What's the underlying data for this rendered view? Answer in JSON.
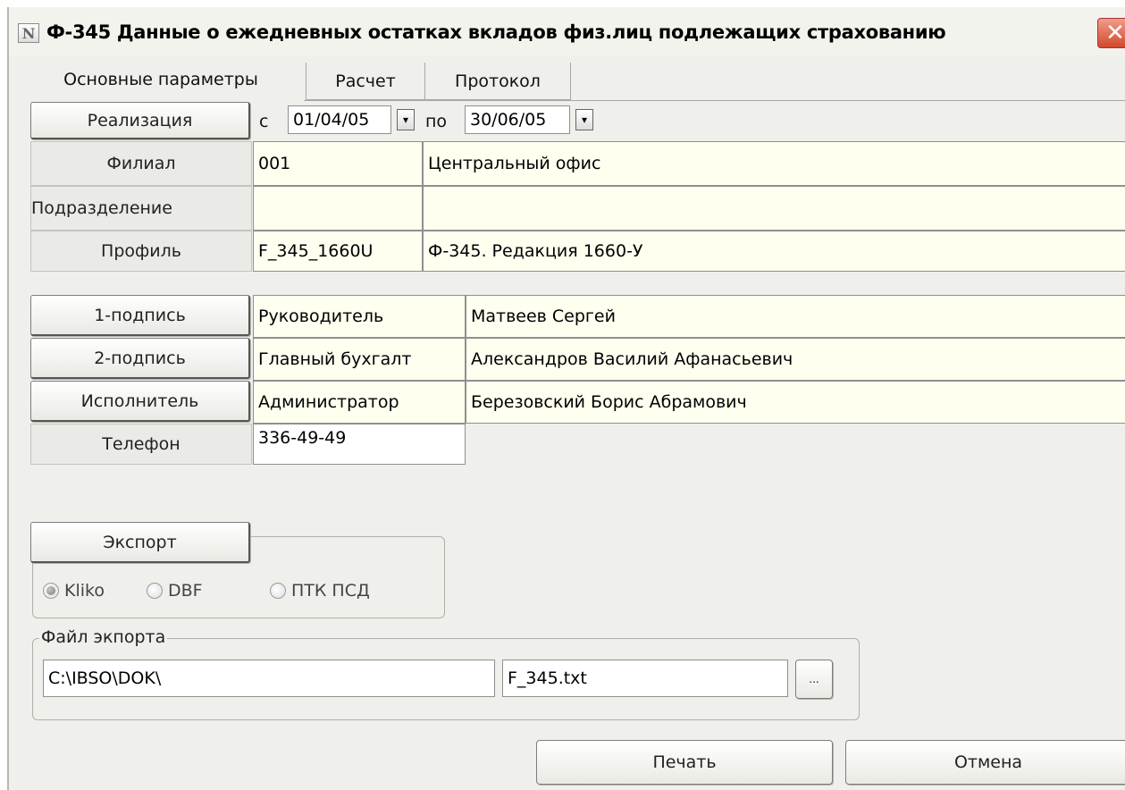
{
  "window": {
    "title": "Ф-345 Данные о ежедневных остатках вкладов физ.лиц подлежащих страхованию",
    "app_icon": "app-logo-icon",
    "close_glyph": "✕"
  },
  "tabs": [
    {
      "label": "Основные параметры",
      "active": true
    },
    {
      "label": "Расчет",
      "active": false
    },
    {
      "label": "Протокол",
      "active": false
    }
  ],
  "period": {
    "button_label": "Реализация",
    "from_label": "с",
    "from_value": "01/04/05",
    "to_label": "по",
    "to_value": "30/06/05",
    "dropdown_glyph": "▾"
  },
  "branch": {
    "label": "Филиал",
    "code": "001",
    "name": "Центральный офис"
  },
  "division": {
    "label": "Подразделение",
    "code": "",
    "name": ""
  },
  "profile": {
    "label": "Профиль",
    "code": "F_345_1660U",
    "name": "Ф-345. Редакция 1660-У"
  },
  "signatures": [
    {
      "button": "1-подпись",
      "position": "Руководитель",
      "name": "Матвеев Сергей"
    },
    {
      "button": "2-подпись",
      "position": "Главный бухгалт",
      "name": "Александров Василий Афанасьевич"
    },
    {
      "button": "Исполнитель",
      "position": "Администратор",
      "name": "Березовский Борис Абрамович"
    }
  ],
  "phone": {
    "label": "Телефон",
    "value": "336-49-49"
  },
  "export": {
    "button_label": "Экспорт",
    "formats": [
      {
        "label": "Kliko",
        "selected": true
      },
      {
        "label": "DBF",
        "selected": false
      },
      {
        "label": "ПТК ПСД",
        "selected": false
      }
    ]
  },
  "export_file": {
    "group_label": "Файл экпорта",
    "path": "C:\\IBSO\\DOK\\",
    "filename": "F_345.txt",
    "browse_label": "..."
  },
  "actions": {
    "print_label": "Печать",
    "cancel_label": "Отмена"
  }
}
